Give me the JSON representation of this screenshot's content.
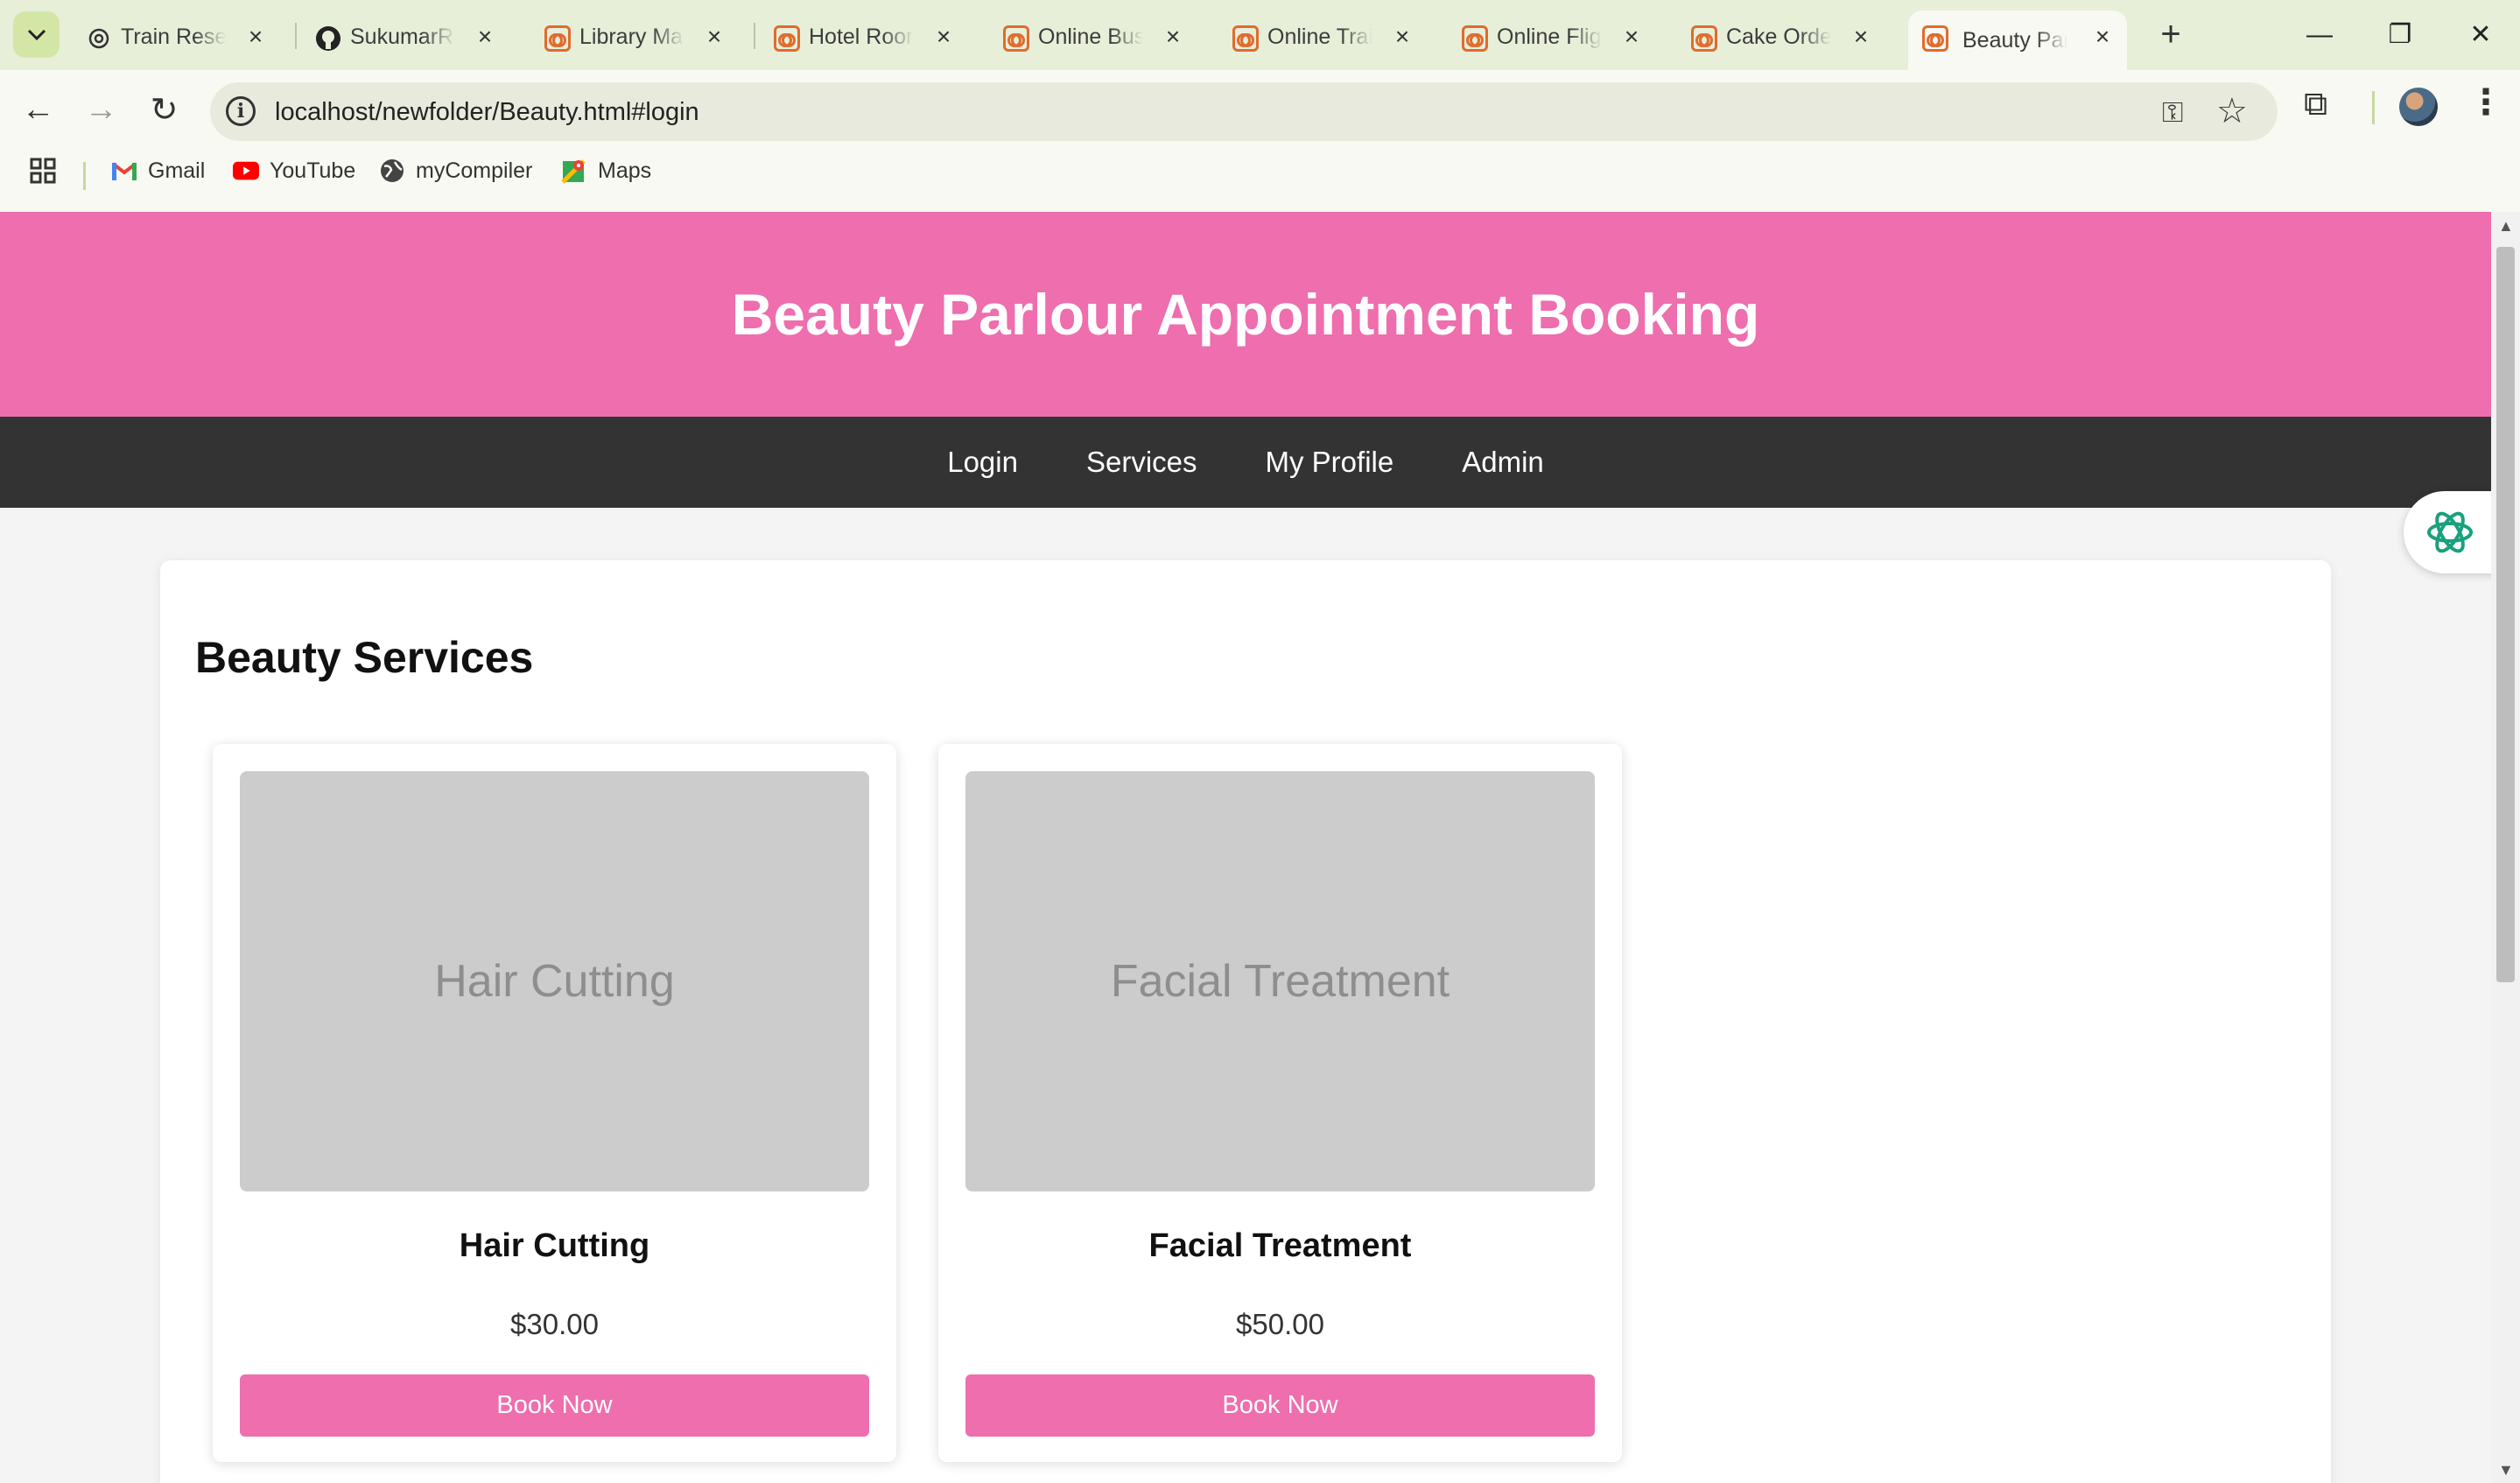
{
  "browser": {
    "tabs": [
      {
        "title": "Train Reserv",
        "icon": "openai-icon"
      },
      {
        "title": "SukumarRa",
        "icon": "github-icon"
      },
      {
        "title": "Library Man",
        "icon": "xampp-icon"
      },
      {
        "title": "Hotel Room",
        "icon": "xampp-icon"
      },
      {
        "title": "Online Bus",
        "icon": "xampp-icon"
      },
      {
        "title": "Online Train",
        "icon": "xampp-icon"
      },
      {
        "title": "Online Fligh",
        "icon": "xampp-icon"
      },
      {
        "title": "Cake Order",
        "icon": "xampp-icon"
      },
      {
        "title": "Beauty Parl",
        "icon": "xampp-icon",
        "active": true
      }
    ],
    "url": "localhost/newfolder/Beauty.html#login",
    "bookmarks": [
      {
        "label": "Gmail",
        "icon": "gmail-icon"
      },
      {
        "label": "YouTube",
        "icon": "youtube-icon"
      },
      {
        "label": "myCompiler",
        "icon": "globe-icon"
      },
      {
        "label": "Maps",
        "icon": "maps-icon"
      }
    ]
  },
  "site": {
    "title": "Beauty Parlour Appointment Booking",
    "nav": [
      "Login",
      "Services",
      "My Profile",
      "Admin"
    ],
    "colors": {
      "header": "#ee6eae",
      "nav": "#333333",
      "button": "#ee6eae"
    }
  },
  "services": {
    "heading": "Beauty Services",
    "items": [
      {
        "image_text": "Hair Cutting",
        "name": "Hair Cutting",
        "price": "$30.00",
        "button": "Book Now"
      },
      {
        "image_text": "Facial Treatment",
        "name": "Facial Treatment",
        "price": "$50.00",
        "button": "Book Now"
      }
    ]
  }
}
